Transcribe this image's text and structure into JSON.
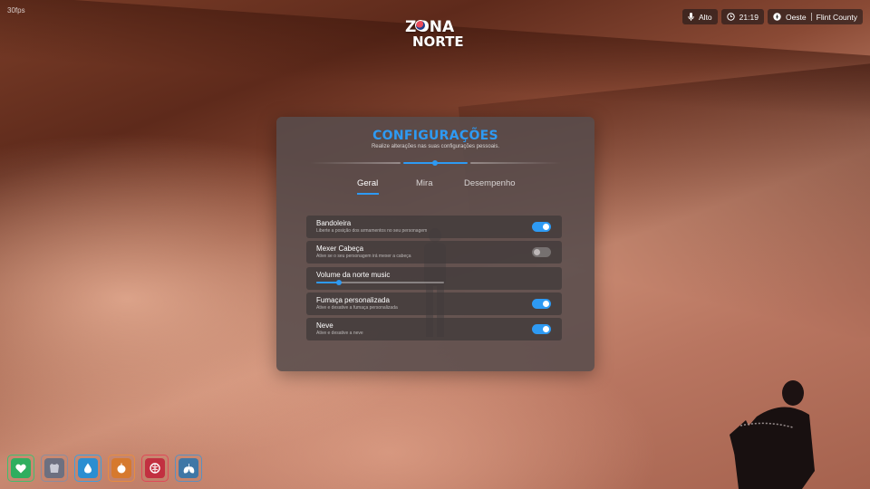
{
  "fps": "30fps",
  "logo": {
    "line1": "ZONA",
    "line2": "NORTE"
  },
  "hud": {
    "voice": {
      "icon": "microphone-icon",
      "label": "Alto"
    },
    "clock": {
      "icon": "clock-icon",
      "label": "21:19"
    },
    "location": {
      "icon": "compass-icon",
      "direction": "Oeste",
      "area": "Flint County"
    }
  },
  "settings": {
    "title": "CONFIGURAÇÕES",
    "subtitle": "Realize alterações nas suas configurações pessoais.",
    "tabs": [
      {
        "label": "Geral",
        "active": true
      },
      {
        "label": "Mira",
        "active": false
      },
      {
        "label": "Desempenho",
        "active": false
      }
    ],
    "items": [
      {
        "label": "Bandoleira",
        "desc": "Liberte a posição dos armamentos no seu personagem",
        "type": "toggle",
        "on": true
      },
      {
        "label": "Mexer Cabeça",
        "desc": "Ative se o seu personagem irá mexer a cabeça",
        "type": "toggle",
        "on": false
      },
      {
        "label": "Volume da norte music",
        "desc": "",
        "type": "slider",
        "value": 0.18
      },
      {
        "label": "Fumaça personalizada",
        "desc": "Ative e desative a fumaça personalizada",
        "type": "toggle",
        "on": true
      },
      {
        "label": "Neve",
        "desc": "Ative e desative a neve",
        "type": "toggle",
        "on": true
      }
    ]
  },
  "status_bar": [
    {
      "name": "health",
      "icon": "heart-icon",
      "color": "#2fae5f",
      "border": "#3fbf6f"
    },
    {
      "name": "armor",
      "icon": "vest-icon",
      "color": "#6d7080",
      "border": "#8a8da0"
    },
    {
      "name": "thirst",
      "icon": "water-drop-icon",
      "color": "#2b8ed1",
      "border": "#3aa0e2"
    },
    {
      "name": "hunger",
      "icon": "food-icon",
      "color": "#d6792e",
      "border": "#e88c3f"
    },
    {
      "name": "stress",
      "icon": "brain-icon",
      "color": "#c23040",
      "border": "#e04858"
    },
    {
      "name": "oxygen",
      "icon": "lungs-icon",
      "color": "#3f77a6",
      "border": "#5a90c0"
    }
  ],
  "colors": {
    "accent": "#2e9af3"
  }
}
